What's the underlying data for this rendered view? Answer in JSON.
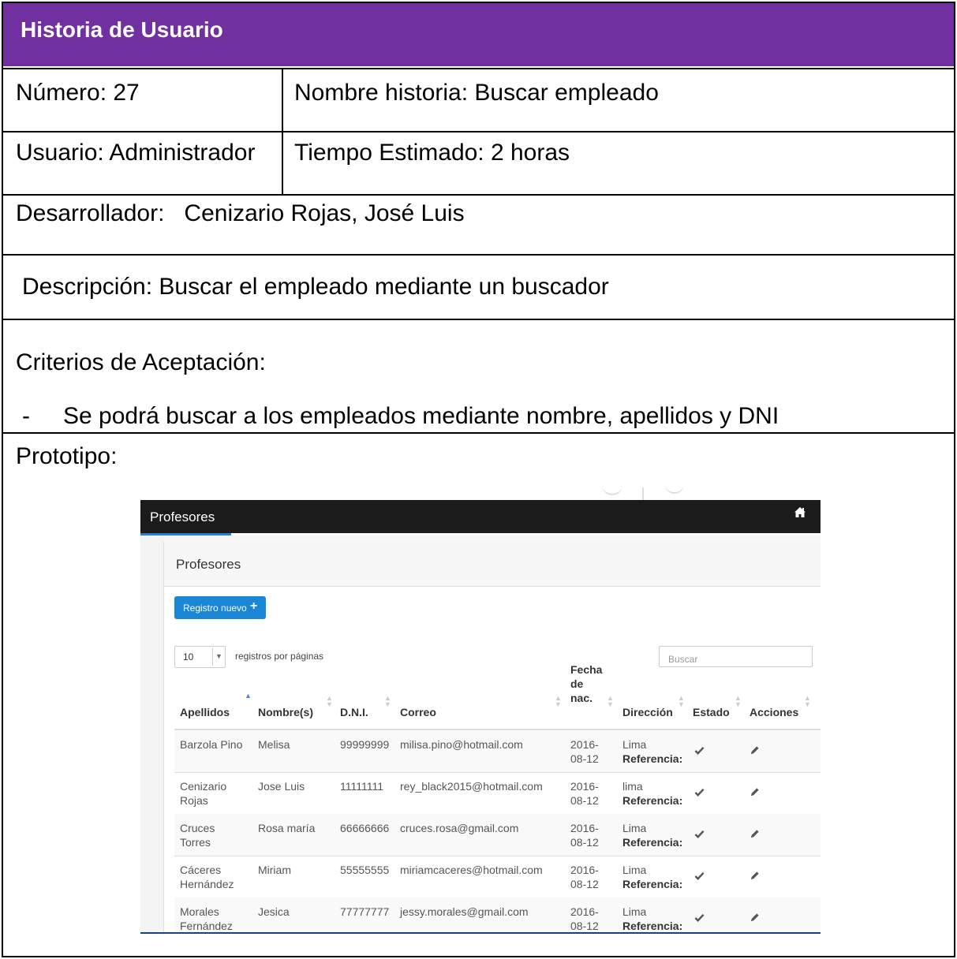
{
  "document": {
    "header_title": "Historia de Usuario",
    "numero": "Número: 27",
    "nombre_historia": "Nombre historia: Buscar empleado",
    "usuario": "Usuario: Administrador",
    "tiempo_estimado": "Tiempo Estimado: 2 horas",
    "desarrollador": "Desarrollador:   Cenizario Rojas, José Luis",
    "descripcion": "Descripción: Buscar el empleado mediante un buscador",
    "criterios_title": "Criterios de Aceptación:",
    "criterio_bullet": "-",
    "criterio_1": "Se podrá buscar a los empleados mediante nombre, apellidos y DNI",
    "prototipo_label": "Prototipo:",
    "header_color": "#7030a0"
  },
  "prototype": {
    "nav_title": "Profesores",
    "home_icon": "home-icon",
    "panel_title": "Profesores",
    "new_button_label": "Registro nuevo",
    "new_button_icon": "plus-icon",
    "page_length_value": "10",
    "page_length_label": "registros por páginas",
    "search_placeholder": "Buscar",
    "accent_color": "#1a87d6",
    "columns": [
      "Apellidos",
      "Nombre(s)",
      "D.N.I.",
      "Correo",
      "Fecha de nac.",
      "Dirección",
      "Estado",
      "Acciones"
    ],
    "fecha_header_lines": [
      "Fecha",
      "de",
      "nac."
    ],
    "rows": [
      {
        "apellidos": [
          "Barzola Pino"
        ],
        "nombre": "Melisa",
        "dni": "99999999",
        "correo": "milisa.pino@hotmail.com",
        "fecha": [
          "2016-",
          "08-12"
        ],
        "direccion": "Lima",
        "referencia": "Referencia:"
      },
      {
        "apellidos": [
          "Cenizario",
          "Rojas"
        ],
        "nombre": "Jose Luis",
        "dni": "11111111",
        "correo": "rey_black2015@hotmail.com",
        "fecha": [
          "2016-",
          "08-12"
        ],
        "direccion": "lima",
        "referencia": "Referencia:"
      },
      {
        "apellidos": [
          "Cruces",
          "Torres"
        ],
        "nombre": "Rosa maría",
        "dni": "66666666",
        "correo": "cruces.rosa@gmail.com",
        "fecha": [
          "2016-",
          "08-12"
        ],
        "direccion": "Lima",
        "referencia": "Referencia:"
      },
      {
        "apellidos": [
          "Cáceres",
          "Hernández"
        ],
        "nombre": "Miriam",
        "dni": "55555555",
        "correo": "miriamcaceres@hotmail.com",
        "fecha": [
          "2016-",
          "08-12"
        ],
        "direccion": "Lima",
        "referencia": "Referencia:"
      },
      {
        "apellidos": [
          "Morales",
          "Fernández"
        ],
        "nombre": "Jesica",
        "dni": "77777777",
        "correo": "jessy.morales@gmail.com",
        "fecha": [
          "2016-",
          "08-12"
        ],
        "direccion": "Lima",
        "referencia": "Referencia:"
      }
    ]
  }
}
